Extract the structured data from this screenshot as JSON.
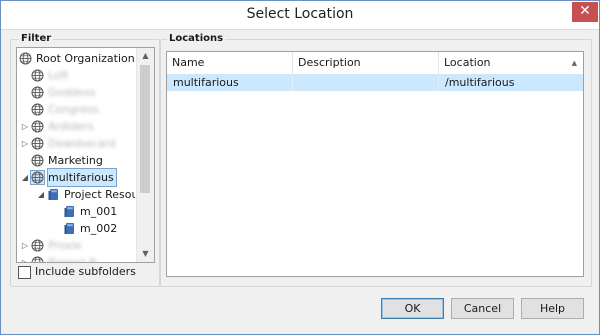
{
  "window": {
    "title": "Select Location",
    "close_glyph": "✕"
  },
  "filter": {
    "group_title": "Filter",
    "tree": [
      {
        "label": "Root Organization",
        "icon": "globe-icon",
        "level": 0,
        "expander": "",
        "blurred": false,
        "selected": false
      },
      {
        "label": "Loft",
        "icon": "globe-icon",
        "level": 1,
        "expander": "",
        "blurred": true,
        "selected": false
      },
      {
        "label": "Goddess",
        "icon": "globe-icon",
        "level": 1,
        "expander": "",
        "blurred": true,
        "selected": false
      },
      {
        "label": "Congress",
        "icon": "globe-icon",
        "level": 1,
        "expander": "",
        "blurred": true,
        "selected": false
      },
      {
        "label": "Ardiders",
        "icon": "globe-icon",
        "level": 1,
        "expander": "▷",
        "blurred": true,
        "selected": false
      },
      {
        "label": "Dewsbocard",
        "icon": "globe-icon",
        "level": 1,
        "expander": "▷",
        "blurred": true,
        "selected": false
      },
      {
        "label": "Marketing",
        "icon": "globe-icon",
        "level": 1,
        "expander": "",
        "blurred": false,
        "selected": false
      },
      {
        "label": "multifarious",
        "icon": "globe-icon",
        "level": 1,
        "expander": "◢",
        "blurred": false,
        "selected": true
      },
      {
        "label": "Project Resources",
        "icon": "database-icon",
        "level": 2,
        "expander": "◢",
        "blurred": false,
        "selected": false
      },
      {
        "label": "m_001",
        "icon": "database-icon",
        "level": 3,
        "expander": "",
        "blurred": false,
        "selected": false
      },
      {
        "label": "m_002",
        "icon": "database-icon",
        "level": 3,
        "expander": "",
        "blurred": false,
        "selected": false
      },
      {
        "label": "Proxie",
        "icon": "globe-icon",
        "level": 1,
        "expander": "▷",
        "blurred": true,
        "selected": false
      },
      {
        "label": "Project R",
        "icon": "globe-icon",
        "level": 1,
        "expander": "▷",
        "blurred": true,
        "selected": false
      }
    ],
    "include_subfolders_label": "Include subfolders",
    "include_subfolders_checked": false
  },
  "locations": {
    "group_title": "Locations",
    "columns": [
      "Name",
      "Description",
      "Location"
    ],
    "sort_indicator": "▲",
    "rows": [
      {
        "name": "multifarious",
        "description": "",
        "location": "/multifarious"
      }
    ]
  },
  "buttons": {
    "ok": "OK",
    "cancel": "Cancel",
    "help": "Help"
  }
}
